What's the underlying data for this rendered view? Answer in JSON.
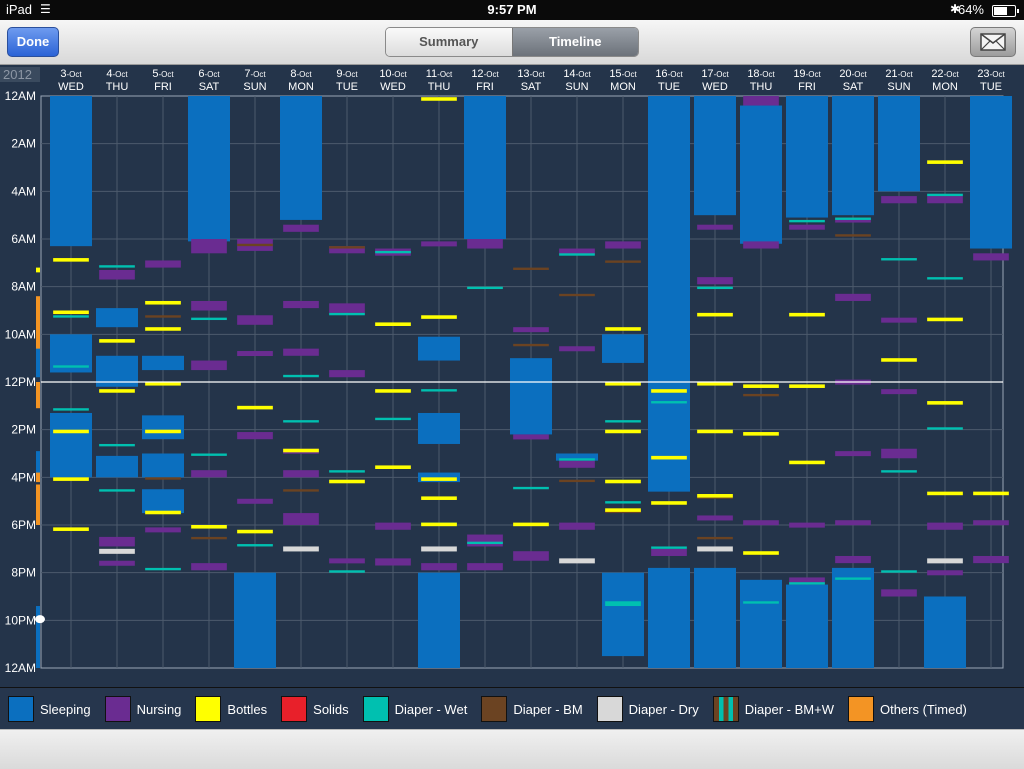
{
  "status": {
    "device": "iPad",
    "time": "9:57 PM",
    "battery": "64%",
    "battery_level": 0.64
  },
  "toolbar": {
    "done_label": "Done",
    "summary_label": "Summary",
    "timeline_label": "Timeline",
    "selected_tab": "Timeline",
    "mail_icon": "mail-icon"
  },
  "legend": [
    {
      "label": "Sleeping",
      "color": "#0b6fbf"
    },
    {
      "label": "Nursing",
      "color": "#6a2c91"
    },
    {
      "label": "Bottles",
      "color": "#ffff00"
    },
    {
      "label": "Solids",
      "color": "#e8202a"
    },
    {
      "label": "Diaper - Wet",
      "color": "#00c0b0"
    },
    {
      "label": "Diaper - BM",
      "color": "#6b4322"
    },
    {
      "label": "Diaper - Dry",
      "color": "#d8d8d8"
    },
    {
      "label": "Diaper - BM+W",
      "color": "striped"
    },
    {
      "label": "Others (Timed)",
      "color": "#f39424"
    }
  ],
  "chart_data": {
    "type": "heatmap",
    "year_label": "2012",
    "y_ticks": [
      "12AM",
      "2AM",
      "4AM",
      "6AM",
      "8AM",
      "10AM",
      "12PM",
      "2PM",
      "4PM",
      "6PM",
      "8PM",
      "10PM",
      "12AM"
    ],
    "y_range_hours": [
      0,
      24
    ],
    "current_time_hour": 21.95,
    "noon_line_hour": 12,
    "grid": true,
    "days": [
      {
        "date": "3",
        "month": "-Oct",
        "weekday": "WED"
      },
      {
        "date": "4",
        "month": "-Oct",
        "weekday": "THU"
      },
      {
        "date": "5",
        "month": "-Oct",
        "weekday": "FRI"
      },
      {
        "date": "6",
        "month": "-Oct",
        "weekday": "SAT"
      },
      {
        "date": "7",
        "month": "-Oct",
        "weekday": "SUN"
      },
      {
        "date": "8",
        "month": "-Oct",
        "weekday": "MON"
      },
      {
        "date": "9",
        "month": "-Oct",
        "weekday": "TUE"
      },
      {
        "date": "10",
        "month": "-Oct",
        "weekday": "WED"
      },
      {
        "date": "11",
        "month": "-Oct",
        "weekday": "THU"
      },
      {
        "date": "12",
        "month": "-Oct",
        "weekday": "FRI"
      },
      {
        "date": "13",
        "month": "-Oct",
        "weekday": "SAT"
      },
      {
        "date": "14",
        "month": "-Oct",
        "weekday": "SUN"
      },
      {
        "date": "15",
        "month": "-Oct",
        "weekday": "MON"
      },
      {
        "date": "16",
        "month": "-Oct",
        "weekday": "TUE"
      },
      {
        "date": "17",
        "month": "-Oct",
        "weekday": "WED"
      },
      {
        "date": "18",
        "month": "-Oct",
        "weekday": "THU"
      },
      {
        "date": "19",
        "month": "-Oct",
        "weekday": "FRI"
      },
      {
        "date": "20",
        "month": "-Oct",
        "weekday": "SAT"
      },
      {
        "date": "21",
        "month": "-Oct",
        "weekday": "SUN"
      },
      {
        "date": "22",
        "month": "-Oct",
        "weekday": "MON"
      },
      {
        "date": "23",
        "month": "-Oct",
        "weekday": "TUE"
      }
    ],
    "side_events": [
      {
        "type": "Others (Timed)",
        "start": 8.4,
        "end": 11.2
      },
      {
        "type": "Others (Timed)",
        "start": 12.0,
        "end": 13.1
      },
      {
        "type": "Others (Timed)",
        "start": 15.0,
        "end": 16.2
      },
      {
        "type": "Others (Timed)",
        "start": 16.3,
        "end": 18.0
      },
      {
        "type": "Bottles",
        "start": 7.2,
        "end": 7.4
      },
      {
        "type": "Sleeping",
        "start": 10.6,
        "end": 11.8
      },
      {
        "type": "Sleeping",
        "start": 14.9,
        "end": 15.8
      },
      {
        "type": "Sleeping",
        "start": 21.4,
        "end": 24
      }
    ],
    "sleep": [
      [
        [
          0,
          6.3
        ],
        [
          10.0,
          11.6
        ],
        [
          13.3,
          16.0
        ]
      ],
      [
        [
          8.9,
          9.7
        ],
        [
          10.9,
          12.2
        ],
        [
          15.1,
          16.0
        ]
      ],
      [
        [
          10.9,
          11.5
        ],
        [
          13.4,
          14.4
        ],
        [
          15.0,
          16.0
        ],
        [
          16.5,
          17.5
        ]
      ],
      [
        [
          0,
          6.1
        ]
      ],
      [
        [
          20.0,
          24
        ]
      ],
      [
        [
          0,
          5.2
        ]
      ],
      [],
      [],
      [
        [
          10.1,
          11.1
        ],
        [
          13.3,
          14.6
        ],
        [
          15.8,
          16.2
        ],
        [
          20.0,
          24
        ]
      ],
      [
        [
          0,
          6.0
        ]
      ],
      [
        [
          11.0,
          14.2
        ]
      ],
      [
        [
          15.0,
          15.3
        ]
      ],
      [
        [
          10.0,
          11.2
        ],
        [
          20.0,
          23.5
        ]
      ],
      [
        [
          0,
          16.6
        ],
        [
          19.8,
          24
        ]
      ],
      [
        [
          0,
          5.0
        ],
        [
          19.8,
          24
        ]
      ],
      [
        [
          0.4,
          6.2
        ],
        [
          20.3,
          24
        ]
      ],
      [
        [
          0,
          5.1
        ],
        [
          20.5,
          24
        ]
      ],
      [
        [
          0,
          5.0
        ],
        [
          19.8,
          24
        ]
      ],
      [
        [
          0,
          4.0
        ]
      ],
      [
        [
          21.0,
          24
        ]
      ],
      [
        [
          0,
          6.4
        ]
      ]
    ],
    "nursing": [
      [],
      [
        [
          7.3,
          7.7
        ],
        [
          18.5,
          18.9
        ],
        [
          19.5,
          19.7
        ]
      ],
      [
        [
          6.9,
          7.2
        ],
        [
          18.1,
          18.3
        ]
      ],
      [
        [
          6.0,
          6.6
        ],
        [
          8.6,
          9.0
        ],
        [
          11.1,
          11.5
        ],
        [
          15.7,
          16.0
        ],
        [
          19.6,
          19.9
        ]
      ],
      [
        [
          6.0,
          6.5
        ],
        [
          9.2,
          9.6
        ],
        [
          10.7,
          10.9
        ],
        [
          14.1,
          14.4
        ],
        [
          16.9,
          17.1
        ]
      ],
      [
        [
          5.4,
          5.7
        ],
        [
          8.6,
          8.9
        ],
        [
          10.6,
          10.9
        ],
        [
          14.8,
          15.0
        ],
        [
          15.7,
          16.0
        ],
        [
          17.5,
          18.0
        ]
      ],
      [
        [
          6.3,
          6.6
        ],
        [
          8.7,
          9.1
        ],
        [
          11.5,
          11.8
        ],
        [
          19.4,
          19.6
        ]
      ],
      [
        [
          6.4,
          6.7
        ],
        [
          17.9,
          18.2
        ],
        [
          19.4,
          19.7
        ]
      ],
      [
        [
          6.1,
          6.3
        ],
        [
          19.6,
          19.9
        ]
      ],
      [
        [
          6.0,
          6.4
        ],
        [
          18.4,
          18.9
        ],
        [
          19.6,
          19.9
        ]
      ],
      [
        [
          9.7,
          9.9
        ],
        [
          14.2,
          14.4
        ],
        [
          19.1,
          19.5
        ]
      ],
      [
        [
          6.4,
          6.6
        ],
        [
          10.5,
          10.7
        ],
        [
          15.3,
          15.6
        ],
        [
          17.9,
          18.2
        ]
      ],
      [
        [
          6.1,
          6.4
        ]
      ],
      [
        [
          19.0,
          19.3
        ]
      ],
      [
        [
          5.4,
          5.6
        ],
        [
          7.6,
          7.9
        ],
        [
          17.6,
          17.8
        ]
      ],
      [
        [
          0,
          0.4
        ],
        [
          6.1,
          6.4
        ],
        [
          17.8,
          18.0
        ]
      ],
      [
        [
          5.4,
          5.6
        ],
        [
          17.9,
          18.1
        ],
        [
          20.2,
          20.5
        ]
      ],
      [
        [
          5.1,
          5.3
        ],
        [
          8.3,
          8.6
        ],
        [
          11.9,
          12.1
        ],
        [
          14.9,
          15.1
        ],
        [
          17.8,
          18.0
        ],
        [
          19.3,
          19.6
        ]
      ],
      [
        [
          4.2,
          4.5
        ],
        [
          9.3,
          9.4
        ],
        [
          12.3,
          12.5
        ],
        [
          14.8,
          15.2
        ],
        [
          20.7,
          21.0
        ]
      ],
      [
        [
          4.2,
          4.5
        ],
        [
          17.9,
          18.2
        ],
        [
          19.9,
          20.1
        ]
      ],
      [
        [
          6.6,
          6.9
        ],
        [
          17.8,
          18.0
        ],
        [
          19.3,
          19.6
        ]
      ]
    ],
    "bottles": [
      [
        [
          6.8,
          6.95
        ],
        [
          9.0,
          9.15
        ],
        [
          14.0,
          14.15
        ],
        [
          16.0,
          16.15
        ],
        [
          18.1,
          18.25
        ]
      ],
      [
        [
          10.2,
          10.35
        ],
        [
          12.3,
          12.45
        ]
      ],
      [
        [
          8.6,
          8.75
        ],
        [
          9.7,
          9.85
        ],
        [
          12.0,
          12.15
        ],
        [
          14.0,
          14.15
        ],
        [
          17.4,
          17.55
        ]
      ],
      [
        [
          18.0,
          18.15
        ]
      ],
      [
        [
          13.0,
          13.15
        ],
        [
          18.2,
          18.35
        ]
      ],
      [
        [
          14.8,
          14.95
        ]
      ],
      [
        [
          16.1,
          16.25
        ]
      ],
      [
        [
          9.5,
          9.65
        ],
        [
          12.3,
          12.45
        ],
        [
          15.5,
          15.65
        ]
      ],
      [
        [
          0.05,
          0.2
        ],
        [
          9.2,
          9.35
        ],
        [
          16.0,
          16.15
        ],
        [
          16.8,
          16.95
        ],
        [
          17.9,
          18.05
        ]
      ],
      [],
      [
        [
          17.9,
          18.05
        ]
      ],
      [],
      [
        [
          9.7,
          9.85
        ],
        [
          12.0,
          12.15
        ],
        [
          14.0,
          14.15
        ],
        [
          16.1,
          16.25
        ],
        [
          17.3,
          17.45
        ]
      ],
      [
        [
          12.3,
          12.45
        ],
        [
          15.1,
          15.25
        ],
        [
          17.0,
          17.15
        ]
      ],
      [
        [
          9.1,
          9.25
        ],
        [
          12.0,
          12.15
        ],
        [
          14.0,
          14.15
        ],
        [
          16.7,
          16.85
        ]
      ],
      [
        [
          12.1,
          12.25
        ],
        [
          14.1,
          14.25
        ],
        [
          19.1,
          19.25
        ]
      ],
      [
        [
          9.1,
          9.25
        ],
        [
          12.1,
          12.25
        ],
        [
          15.3,
          15.45
        ]
      ],
      [],
      [
        [
          11.0,
          11.15
        ]
      ],
      [
        [
          2.7,
          2.85
        ],
        [
          9.3,
          9.45
        ],
        [
          12.8,
          12.95
        ],
        [
          16.6,
          16.75
        ]
      ],
      [
        [
          16.6,
          16.75
        ]
      ]
    ],
    "wet": [
      [
        [
          9.2,
          9.3
        ],
        [
          11.3,
          11.4
        ],
        [
          13.1,
          13.2
        ]
      ],
      [
        [
          7.1,
          7.2
        ],
        [
          14.6,
          14.7
        ],
        [
          16.5,
          16.6
        ]
      ],
      [
        [
          19.8,
          19.9
        ]
      ],
      [
        [
          9.3,
          9.4
        ],
        [
          15.0,
          15.1
        ]
      ],
      [
        [
          18.8,
          18.9
        ]
      ],
      [
        [
          11.7,
          11.8
        ],
        [
          13.6,
          13.7
        ]
      ],
      [
        [
          9.1,
          9.2
        ],
        [
          15.7,
          15.8
        ],
        [
          19.9,
          20.0
        ]
      ],
      [
        [
          6.5,
          6.6
        ],
        [
          13.5,
          13.6
        ]
      ],
      [
        [
          12.3,
          12.4
        ],
        [
          17.9,
          18.0
        ]
      ],
      [
        [
          8.0,
          8.1
        ],
        [
          18.7,
          18.8
        ]
      ],
      [
        [
          16.4,
          16.5
        ]
      ],
      [
        [
          6.6,
          6.7
        ],
        [
          15.2,
          15.3
        ]
      ],
      [
        [
          13.6,
          13.7
        ],
        [
          17.0,
          17.1
        ],
        [
          21.2,
          21.4
        ]
      ],
      [
        [
          12.8,
          12.9
        ],
        [
          18.9,
          19.0
        ]
      ],
      [
        [
          8.0,
          8.1
        ]
      ],
      [
        [
          21.2,
          21.3
        ]
      ],
      [
        [
          5.2,
          5.3
        ],
        [
          20.4,
          20.5
        ]
      ],
      [
        [
          5.1,
          5.2
        ],
        [
          20.2,
          20.3
        ]
      ],
      [
        [
          6.8,
          6.9
        ],
        [
          15.7,
          15.8
        ],
        [
          19.9,
          20.0
        ]
      ],
      [
        [
          4.1,
          4.2
        ],
        [
          7.6,
          7.7
        ],
        [
          13.9,
          14.0
        ]
      ],
      []
    ],
    "bm": [
      [],
      [],
      [
        [
          9.2,
          9.3
        ],
        [
          16.0,
          16.1
        ]
      ],
      [
        [
          18.5,
          18.6
        ]
      ],
      [
        [
          6.2,
          6.3
        ]
      ],
      [
        [
          16.5,
          16.6
        ]
      ],
      [
        [
          6.3,
          6.4
        ]
      ],
      [],
      [],
      [],
      [
        [
          7.2,
          7.3
        ],
        [
          10.4,
          10.5
        ]
      ],
      [
        [
          8.3,
          8.4
        ],
        [
          16.1,
          16.2
        ]
      ],
      [
        [
          6.9,
          7.0
        ],
        [
          17.4,
          17.5
        ]
      ],
      [],
      [
        [
          16.8,
          16.9
        ],
        [
          18.5,
          18.6
        ]
      ],
      [
        [
          12.5,
          12.6
        ]
      ],
      [],
      [
        [
          5.8,
          5.9
        ]
      ],
      [],
      [],
      []
    ],
    "dry": [
      [],
      [
        [
          19.0,
          19.2
        ]
      ],
      [],
      [],
      [],
      [
        [
          18.9,
          19.1
        ]
      ],
      [],
      [],
      [
        [
          18.9,
          19.1
        ]
      ],
      [],
      [],
      [
        [
          19.4,
          19.6
        ]
      ],
      [],
      [],
      [
        [
          18.9,
          19.1
        ]
      ],
      [],
      [],
      [],
      [],
      [
        [
          19.4,
          19.6
        ]
      ],
      []
    ]
  }
}
